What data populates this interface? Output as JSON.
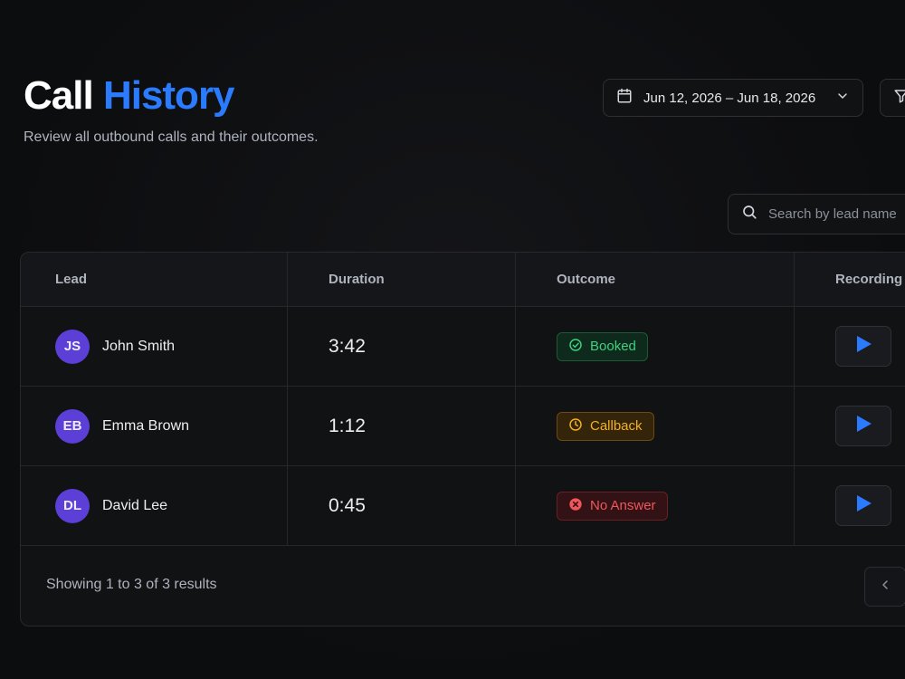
{
  "header": {
    "title_part1": "Call",
    "title_part2": "History",
    "subtitle": "Review all outbound calls and their outcomes."
  },
  "date_filter": {
    "label": "Jun 12, 2026 – Jun 18, 2026",
    "icon": "calendar-icon"
  },
  "search": {
    "placeholder": "Search by lead name",
    "value": ""
  },
  "table": {
    "columns": [
      "Lead",
      "Duration",
      "Outcome",
      "Recording"
    ],
    "rows": [
      {
        "initials": "JS",
        "name": "John Smith",
        "duration": "3:42",
        "outcome": "Booked",
        "outcome_status": "booked"
      },
      {
        "initials": "EB",
        "name": "Emma Brown",
        "duration": "1:12",
        "outcome": "Callback",
        "outcome_status": "callback"
      },
      {
        "initials": "DL",
        "name": "David Lee",
        "duration": "0:45",
        "outcome": "No Answer",
        "outcome_status": "no-answer"
      }
    ]
  },
  "pagination": {
    "summary": "Showing 1 to 3 of 3 results"
  },
  "colors": {
    "accent": "#2b7bff",
    "avatar": "#5b3fd6",
    "booked": "#3fd07e",
    "callback": "#f5b11c",
    "no_answer": "#f0565b"
  }
}
